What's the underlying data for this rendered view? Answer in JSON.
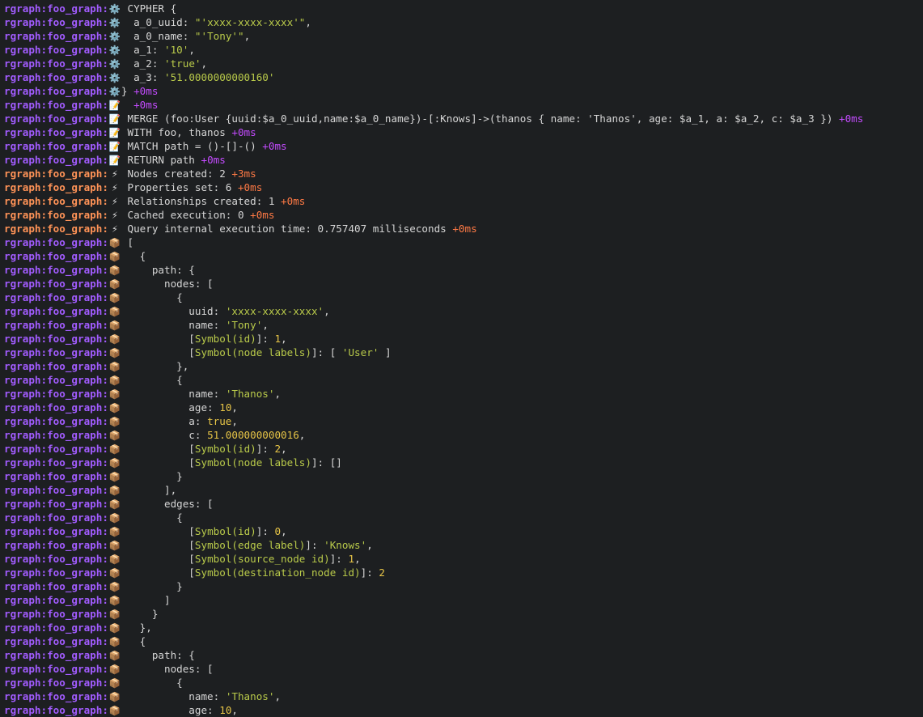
{
  "terminal": {
    "prefix": "rgraph:foo_graph:",
    "colors": {
      "purple": "#a25cff",
      "orange": "#ff9357",
      "string": "#b9ca4a",
      "number": "#e7c547",
      "background": "#1d1f21"
    },
    "icons": {
      "gear": "⚙️",
      "memo": "📝",
      "bolt": "⚡",
      "package": "📦"
    },
    "lines": [
      {
        "c": "purple",
        "i": "gear",
        "t": [
          [
            "k",
            " CYPHER {"
          ]
        ]
      },
      {
        "c": "purple",
        "i": "gear",
        "t": [
          [
            "k",
            "  a_0_uuid: "
          ],
          [
            "s",
            "\"'xxxx-xxxx-xxxx'\""
          ],
          [
            "k",
            ","
          ]
        ]
      },
      {
        "c": "purple",
        "i": "gear",
        "t": [
          [
            "k",
            "  a_0_name: "
          ],
          [
            "s",
            "\"'Tony'\""
          ],
          [
            "k",
            ","
          ]
        ]
      },
      {
        "c": "purple",
        "i": "gear",
        "t": [
          [
            "k",
            "  a_1: "
          ],
          [
            "s",
            "'10'"
          ],
          [
            "k",
            ","
          ]
        ]
      },
      {
        "c": "purple",
        "i": "gear",
        "t": [
          [
            "k",
            "  a_2: "
          ],
          [
            "s",
            "'true'"
          ],
          [
            "k",
            ","
          ]
        ]
      },
      {
        "c": "purple",
        "i": "gear",
        "t": [
          [
            "k",
            "  a_3: "
          ],
          [
            "s",
            "'51.0000000000160'"
          ]
        ]
      },
      {
        "c": "purple",
        "i": "gear",
        "t": [
          [
            "k",
            "} "
          ],
          [
            "tp",
            "+0ms"
          ]
        ]
      },
      {
        "c": "purple",
        "i": "memo",
        "t": [
          [
            "k",
            "  "
          ],
          [
            "tp",
            "+0ms"
          ]
        ]
      },
      {
        "c": "purple",
        "i": "memo",
        "t": [
          [
            "k",
            " MERGE (foo:User {uuid:$a_0_uuid,name:$a_0_name})-[:Knows]->(thanos { name: 'Thanos', age: $a_1, a: $a_2, c: $a_3 }) "
          ],
          [
            "tp",
            "+0ms"
          ]
        ]
      },
      {
        "c": "purple",
        "i": "memo",
        "t": [
          [
            "k",
            " WITH foo, thanos "
          ],
          [
            "tp",
            "+0ms"
          ]
        ]
      },
      {
        "c": "purple",
        "i": "memo",
        "t": [
          [
            "k",
            " MATCH path = ()-[]-() "
          ],
          [
            "tp",
            "+0ms"
          ]
        ]
      },
      {
        "c": "purple",
        "i": "memo",
        "t": [
          [
            "k",
            " RETURN path "
          ],
          [
            "tp",
            "+0ms"
          ]
        ]
      },
      {
        "c": "orange",
        "i": "bolt",
        "t": [
          [
            "k",
            " Nodes created: 2 "
          ],
          [
            "to",
            "+3ms"
          ]
        ]
      },
      {
        "c": "orange",
        "i": "bolt",
        "t": [
          [
            "k",
            " Properties set: 6 "
          ],
          [
            "to",
            "+0ms"
          ]
        ]
      },
      {
        "c": "orange",
        "i": "bolt",
        "t": [
          [
            "k",
            " Relationships created: 1 "
          ],
          [
            "to",
            "+0ms"
          ]
        ]
      },
      {
        "c": "orange",
        "i": "bolt",
        "t": [
          [
            "k",
            " Cached execution: 0 "
          ],
          [
            "to",
            "+0ms"
          ]
        ]
      },
      {
        "c": "orange",
        "i": "bolt",
        "t": [
          [
            "k",
            " Query internal execution time: 0.757407 milliseconds "
          ],
          [
            "to",
            "+0ms"
          ]
        ]
      },
      {
        "c": "purple",
        "i": "package",
        "t": [
          [
            "k",
            " ["
          ]
        ]
      },
      {
        "c": "purple",
        "i": "package",
        "t": [
          [
            "k",
            "   {"
          ]
        ]
      },
      {
        "c": "purple",
        "i": "package",
        "t": [
          [
            "k",
            "     path: {"
          ]
        ]
      },
      {
        "c": "purple",
        "i": "package",
        "t": [
          [
            "k",
            "       nodes: ["
          ]
        ]
      },
      {
        "c": "purple",
        "i": "package",
        "t": [
          [
            "k",
            "         {"
          ]
        ]
      },
      {
        "c": "purple",
        "i": "package",
        "t": [
          [
            "k",
            "           uuid: "
          ],
          [
            "s",
            "'xxxx-xxxx-xxxx'"
          ],
          [
            "k",
            ","
          ]
        ]
      },
      {
        "c": "purple",
        "i": "package",
        "t": [
          [
            "k",
            "           name: "
          ],
          [
            "s",
            "'Tony'"
          ],
          [
            "k",
            ","
          ]
        ]
      },
      {
        "c": "purple",
        "i": "package",
        "t": [
          [
            "k",
            "           ["
          ],
          [
            "sym",
            "Symbol(id)"
          ],
          [
            "k",
            "]: "
          ],
          [
            "n",
            "1"
          ],
          [
            "k",
            ","
          ]
        ]
      },
      {
        "c": "purple",
        "i": "package",
        "t": [
          [
            "k",
            "           ["
          ],
          [
            "sym",
            "Symbol(node labels)"
          ],
          [
            "k",
            "]: [ "
          ],
          [
            "s",
            "'User'"
          ],
          [
            "k",
            " ]"
          ]
        ]
      },
      {
        "c": "purple",
        "i": "package",
        "t": [
          [
            "k",
            "         },"
          ]
        ]
      },
      {
        "c": "purple",
        "i": "package",
        "t": [
          [
            "k",
            "         {"
          ]
        ]
      },
      {
        "c": "purple",
        "i": "package",
        "t": [
          [
            "k",
            "           name: "
          ],
          [
            "s",
            "'Thanos'"
          ],
          [
            "k",
            ","
          ]
        ]
      },
      {
        "c": "purple",
        "i": "package",
        "t": [
          [
            "k",
            "           age: "
          ],
          [
            "n",
            "10"
          ],
          [
            "k",
            ","
          ]
        ]
      },
      {
        "c": "purple",
        "i": "package",
        "t": [
          [
            "k",
            "           a: "
          ],
          [
            "b",
            "true"
          ],
          [
            "k",
            ","
          ]
        ]
      },
      {
        "c": "purple",
        "i": "package",
        "t": [
          [
            "k",
            "           c: "
          ],
          [
            "n",
            "51.000000000016"
          ],
          [
            "k",
            ","
          ]
        ]
      },
      {
        "c": "purple",
        "i": "package",
        "t": [
          [
            "k",
            "           ["
          ],
          [
            "sym",
            "Symbol(id)"
          ],
          [
            "k",
            "]: "
          ],
          [
            "n",
            "2"
          ],
          [
            "k",
            ","
          ]
        ]
      },
      {
        "c": "purple",
        "i": "package",
        "t": [
          [
            "k",
            "           ["
          ],
          [
            "sym",
            "Symbol(node labels)"
          ],
          [
            "k",
            "]: []"
          ]
        ]
      },
      {
        "c": "purple",
        "i": "package",
        "t": [
          [
            "k",
            "         }"
          ]
        ]
      },
      {
        "c": "purple",
        "i": "package",
        "t": [
          [
            "k",
            "       ],"
          ]
        ]
      },
      {
        "c": "purple",
        "i": "package",
        "t": [
          [
            "k",
            "       edges: ["
          ]
        ]
      },
      {
        "c": "purple",
        "i": "package",
        "t": [
          [
            "k",
            "         {"
          ]
        ]
      },
      {
        "c": "purple",
        "i": "package",
        "t": [
          [
            "k",
            "           ["
          ],
          [
            "sym",
            "Symbol(id)"
          ],
          [
            "k",
            "]: "
          ],
          [
            "n",
            "0"
          ],
          [
            "k",
            ","
          ]
        ]
      },
      {
        "c": "purple",
        "i": "package",
        "t": [
          [
            "k",
            "           ["
          ],
          [
            "sym",
            "Symbol(edge label)"
          ],
          [
            "k",
            "]: "
          ],
          [
            "s",
            "'Knows'"
          ],
          [
            "k",
            ","
          ]
        ]
      },
      {
        "c": "purple",
        "i": "package",
        "t": [
          [
            "k",
            "           ["
          ],
          [
            "sym",
            "Symbol(source_node id)"
          ],
          [
            "k",
            "]: "
          ],
          [
            "n",
            "1"
          ],
          [
            "k",
            ","
          ]
        ]
      },
      {
        "c": "purple",
        "i": "package",
        "t": [
          [
            "k",
            "           ["
          ],
          [
            "sym",
            "Symbol(destination_node id)"
          ],
          [
            "k",
            "]: "
          ],
          [
            "n",
            "2"
          ]
        ]
      },
      {
        "c": "purple",
        "i": "package",
        "t": [
          [
            "k",
            "         }"
          ]
        ]
      },
      {
        "c": "purple",
        "i": "package",
        "t": [
          [
            "k",
            "       ]"
          ]
        ]
      },
      {
        "c": "purple",
        "i": "package",
        "t": [
          [
            "k",
            "     }"
          ]
        ]
      },
      {
        "c": "purple",
        "i": "package",
        "t": [
          [
            "k",
            "   },"
          ]
        ]
      },
      {
        "c": "purple",
        "i": "package",
        "t": [
          [
            "k",
            "   {"
          ]
        ]
      },
      {
        "c": "purple",
        "i": "package",
        "t": [
          [
            "k",
            "     path: {"
          ]
        ]
      },
      {
        "c": "purple",
        "i": "package",
        "t": [
          [
            "k",
            "       nodes: ["
          ]
        ]
      },
      {
        "c": "purple",
        "i": "package",
        "t": [
          [
            "k",
            "         {"
          ]
        ]
      },
      {
        "c": "purple",
        "i": "package",
        "t": [
          [
            "k",
            "           name: "
          ],
          [
            "s",
            "'Thanos'"
          ],
          [
            "k",
            ","
          ]
        ]
      },
      {
        "c": "purple",
        "i": "package",
        "t": [
          [
            "k",
            "           age: "
          ],
          [
            "n",
            "10"
          ],
          [
            "k",
            ","
          ]
        ]
      }
    ]
  }
}
